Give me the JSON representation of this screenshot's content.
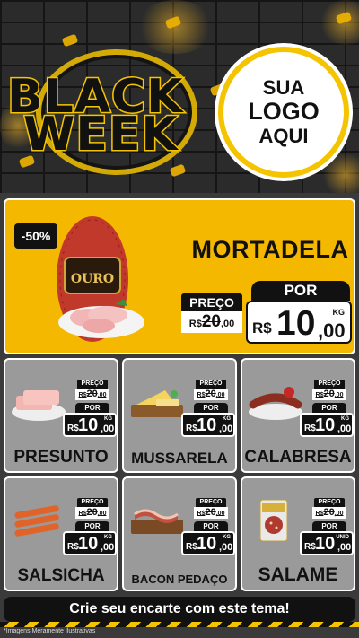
{
  "header": {
    "title_line1": "BLACK",
    "title_line2": "WEEK",
    "logo_line1": "SUA",
    "logo_line2": "LOGO",
    "logo_line3": "AQUI"
  },
  "featured": {
    "badge": "-50%",
    "name": "MORTADELA",
    "package_brand": "OURO",
    "price_label": "PREÇO",
    "old_price_currency": "R$",
    "old_price_int": "20",
    "old_price_dec": ",00",
    "por_label": "POR",
    "currency": "R$",
    "price_int": "10",
    "price_dec": ",00",
    "unit": "KG"
  },
  "products": [
    {
      "name": "PRESUNTO",
      "price_label": "PREÇO",
      "old_currency": "R$",
      "old_int": "20",
      "old_dec": ",00",
      "por_label": "POR",
      "currency": "R$",
      "price_int": "10",
      "price_dec": ",00",
      "unit": "KG",
      "icon": "ham-icon"
    },
    {
      "name": "MUSSARELA",
      "price_label": "PREÇO",
      "old_currency": "R$",
      "old_int": "20",
      "old_dec": ",00",
      "por_label": "POR",
      "currency": "R$",
      "price_int": "10",
      "price_dec": ",00",
      "unit": "KG",
      "icon": "cheese-icon"
    },
    {
      "name": "CALABRESA",
      "price_label": "PREÇO",
      "old_currency": "R$",
      "old_int": "20",
      "old_dec": ",00",
      "por_label": "POR",
      "currency": "R$",
      "price_int": "10",
      "price_dec": ",00",
      "unit": "KG",
      "icon": "sausage-icon"
    },
    {
      "name": "SALSICHA",
      "price_label": "PREÇO",
      "old_currency": "R$",
      "old_int": "20",
      "old_dec": ",00",
      "por_label": "POR",
      "currency": "R$",
      "price_int": "10",
      "price_dec": ",00",
      "unit": "KG",
      "icon": "hotdog-sausage-icon"
    },
    {
      "name": "BACON PEDAÇO",
      "price_label": "PREÇO",
      "old_currency": "R$",
      "old_int": "20",
      "old_dec": ",00",
      "por_label": "POR",
      "currency": "R$",
      "price_int": "10",
      "price_dec": ",00",
      "unit": "KG",
      "icon": "bacon-icon"
    },
    {
      "name": "SALAME",
      "price_label": "PREÇO",
      "old_currency": "R$",
      "old_int": "20",
      "old_dec": ",00",
      "por_label": "POR",
      "currency": "R$",
      "price_int": "10",
      "price_dec": ",00",
      "unit": "UNID",
      "icon": "salami-icon"
    }
  ],
  "footer": {
    "cta": "Crie seu encarte com este tema!",
    "disclaimer": "*Imagens Meramente Ilustrativas"
  },
  "colors": {
    "accent_yellow": "#f5b800",
    "dark": "#111111",
    "card_gray": "#9a9a9a"
  }
}
